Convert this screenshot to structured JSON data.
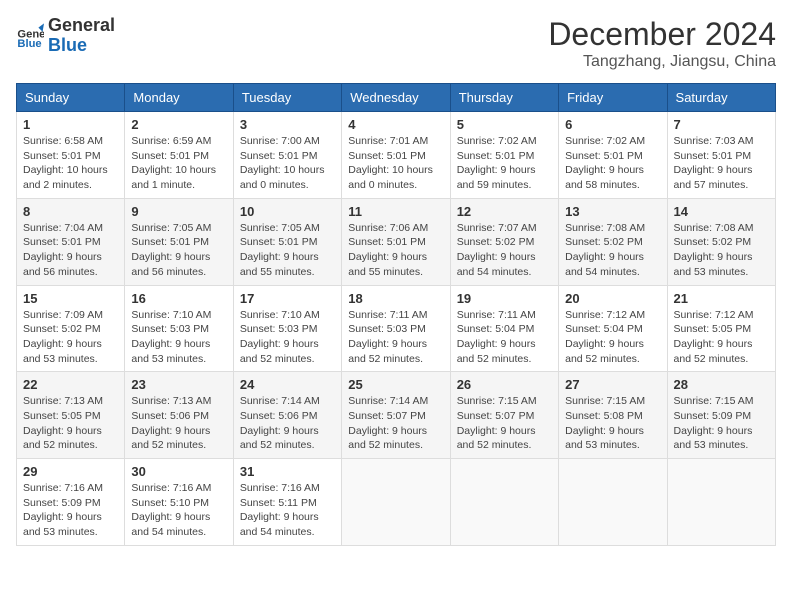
{
  "logo": {
    "line1": "General",
    "line2": "Blue"
  },
  "title": "December 2024",
  "location": "Tangzhang, Jiangsu, China",
  "days_of_week": [
    "Sunday",
    "Monday",
    "Tuesday",
    "Wednesday",
    "Thursday",
    "Friday",
    "Saturday"
  ],
  "weeks": [
    [
      {
        "day": "1",
        "info": "Sunrise: 6:58 AM\nSunset: 5:01 PM\nDaylight: 10 hours\nand 2 minutes."
      },
      {
        "day": "2",
        "info": "Sunrise: 6:59 AM\nSunset: 5:01 PM\nDaylight: 10 hours\nand 1 minute."
      },
      {
        "day": "3",
        "info": "Sunrise: 7:00 AM\nSunset: 5:01 PM\nDaylight: 10 hours\nand 0 minutes."
      },
      {
        "day": "4",
        "info": "Sunrise: 7:01 AM\nSunset: 5:01 PM\nDaylight: 10 hours\nand 0 minutes."
      },
      {
        "day": "5",
        "info": "Sunrise: 7:02 AM\nSunset: 5:01 PM\nDaylight: 9 hours\nand 59 minutes."
      },
      {
        "day": "6",
        "info": "Sunrise: 7:02 AM\nSunset: 5:01 PM\nDaylight: 9 hours\nand 58 minutes."
      },
      {
        "day": "7",
        "info": "Sunrise: 7:03 AM\nSunset: 5:01 PM\nDaylight: 9 hours\nand 57 minutes."
      }
    ],
    [
      {
        "day": "8",
        "info": "Sunrise: 7:04 AM\nSunset: 5:01 PM\nDaylight: 9 hours\nand 56 minutes."
      },
      {
        "day": "9",
        "info": "Sunrise: 7:05 AM\nSunset: 5:01 PM\nDaylight: 9 hours\nand 56 minutes."
      },
      {
        "day": "10",
        "info": "Sunrise: 7:05 AM\nSunset: 5:01 PM\nDaylight: 9 hours\nand 55 minutes."
      },
      {
        "day": "11",
        "info": "Sunrise: 7:06 AM\nSunset: 5:01 PM\nDaylight: 9 hours\nand 55 minutes."
      },
      {
        "day": "12",
        "info": "Sunrise: 7:07 AM\nSunset: 5:02 PM\nDaylight: 9 hours\nand 54 minutes."
      },
      {
        "day": "13",
        "info": "Sunrise: 7:08 AM\nSunset: 5:02 PM\nDaylight: 9 hours\nand 54 minutes."
      },
      {
        "day": "14",
        "info": "Sunrise: 7:08 AM\nSunset: 5:02 PM\nDaylight: 9 hours\nand 53 minutes."
      }
    ],
    [
      {
        "day": "15",
        "info": "Sunrise: 7:09 AM\nSunset: 5:02 PM\nDaylight: 9 hours\nand 53 minutes."
      },
      {
        "day": "16",
        "info": "Sunrise: 7:10 AM\nSunset: 5:03 PM\nDaylight: 9 hours\nand 53 minutes."
      },
      {
        "day": "17",
        "info": "Sunrise: 7:10 AM\nSunset: 5:03 PM\nDaylight: 9 hours\nand 52 minutes."
      },
      {
        "day": "18",
        "info": "Sunrise: 7:11 AM\nSunset: 5:03 PM\nDaylight: 9 hours\nand 52 minutes."
      },
      {
        "day": "19",
        "info": "Sunrise: 7:11 AM\nSunset: 5:04 PM\nDaylight: 9 hours\nand 52 minutes."
      },
      {
        "day": "20",
        "info": "Sunrise: 7:12 AM\nSunset: 5:04 PM\nDaylight: 9 hours\nand 52 minutes."
      },
      {
        "day": "21",
        "info": "Sunrise: 7:12 AM\nSunset: 5:05 PM\nDaylight: 9 hours\nand 52 minutes."
      }
    ],
    [
      {
        "day": "22",
        "info": "Sunrise: 7:13 AM\nSunset: 5:05 PM\nDaylight: 9 hours\nand 52 minutes."
      },
      {
        "day": "23",
        "info": "Sunrise: 7:13 AM\nSunset: 5:06 PM\nDaylight: 9 hours\nand 52 minutes."
      },
      {
        "day": "24",
        "info": "Sunrise: 7:14 AM\nSunset: 5:06 PM\nDaylight: 9 hours\nand 52 minutes."
      },
      {
        "day": "25",
        "info": "Sunrise: 7:14 AM\nSunset: 5:07 PM\nDaylight: 9 hours\nand 52 minutes."
      },
      {
        "day": "26",
        "info": "Sunrise: 7:15 AM\nSunset: 5:07 PM\nDaylight: 9 hours\nand 52 minutes."
      },
      {
        "day": "27",
        "info": "Sunrise: 7:15 AM\nSunset: 5:08 PM\nDaylight: 9 hours\nand 53 minutes."
      },
      {
        "day": "28",
        "info": "Sunrise: 7:15 AM\nSunset: 5:09 PM\nDaylight: 9 hours\nand 53 minutes."
      }
    ],
    [
      {
        "day": "29",
        "info": "Sunrise: 7:16 AM\nSunset: 5:09 PM\nDaylight: 9 hours\nand 53 minutes."
      },
      {
        "day": "30",
        "info": "Sunrise: 7:16 AM\nSunset: 5:10 PM\nDaylight: 9 hours\nand 54 minutes."
      },
      {
        "day": "31",
        "info": "Sunrise: 7:16 AM\nSunset: 5:11 PM\nDaylight: 9 hours\nand 54 minutes."
      },
      {
        "day": "",
        "info": ""
      },
      {
        "day": "",
        "info": ""
      },
      {
        "day": "",
        "info": ""
      },
      {
        "day": "",
        "info": ""
      }
    ]
  ]
}
